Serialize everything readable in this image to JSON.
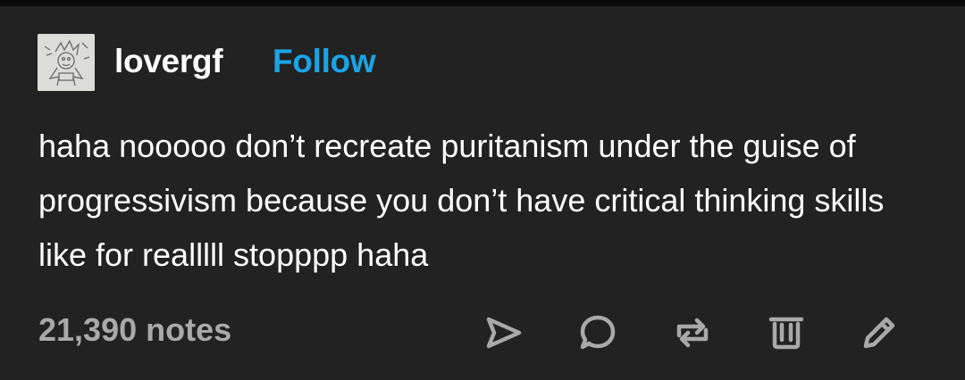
{
  "post": {
    "username": "lovergf",
    "follow_label": "Follow",
    "body": "haha nooooo don’t recreate puritanism under the guise of progressivism because you don’t have critical thinking skills like for realllll stopppp haha",
    "notes": "21,390 notes"
  },
  "actions": [
    {
      "name": "share",
      "icon": "send-icon"
    },
    {
      "name": "reply",
      "icon": "speech-bubble-icon"
    },
    {
      "name": "reblog",
      "icon": "reblog-icon"
    },
    {
      "name": "delete",
      "icon": "trash-icon"
    },
    {
      "name": "edit",
      "icon": "pencil-icon"
    }
  ],
  "colors": {
    "background": "#222222",
    "text": "#ffffff",
    "follow": "#1ca3e6",
    "muted": "#a9a9a9"
  }
}
